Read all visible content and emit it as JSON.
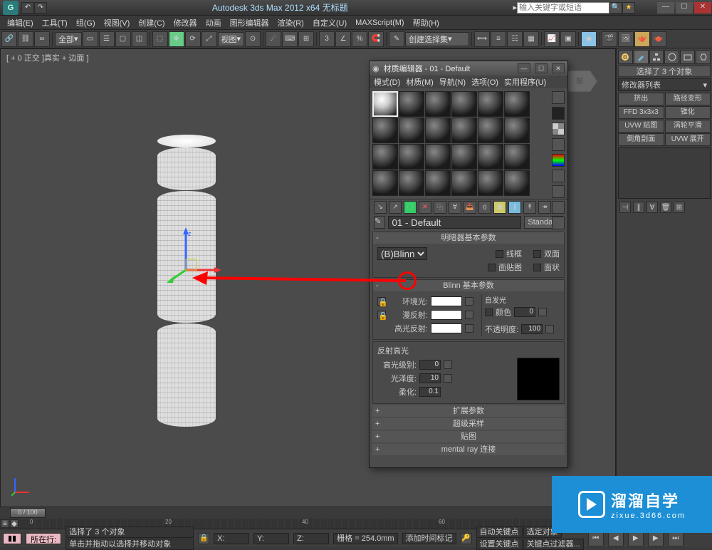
{
  "app": {
    "title": "Autodesk 3ds Max  2012  x64   无标题",
    "search_ph": "输入关键字或短语"
  },
  "menu": [
    "编辑(E)",
    "工具(T)",
    "组(G)",
    "视图(V)",
    "创建(C)",
    "修改器",
    "动画",
    "图形编辑器",
    "渲染(R)",
    "自定义(U)",
    "MAXScript(M)",
    "帮助(H)"
  ],
  "toolbar": {
    "all": "全部",
    "view": "视图",
    "selset": "创建选择集"
  },
  "viewport": {
    "label": "[ + 0 正交 ]真实 + 边面 ]"
  },
  "cmdpanel": {
    "sel": "选择了 3 个对象",
    "modlist": "修改器列表",
    "mods": [
      "挤出",
      "路径变形",
      "FFD 3x3x3",
      "锥化",
      "UVW 贴图",
      "涡轮平滑",
      "倒角剖面",
      "UVW 展开"
    ]
  },
  "mateditor": {
    "title": "材质编辑器 - 01 - Default",
    "menu": [
      "模式(D)",
      "材质(M)",
      "导航(N)",
      "选项(O)",
      "实用程序(U)"
    ],
    "name": "01 - Default",
    "standard": "Standard",
    "rollouts": {
      "shader_hdr": "明暗器基本参数",
      "shader": "(B)Blinn",
      "wire": "线框",
      "twoSided": "双面",
      "faceMap": "面贴图",
      "faceted": "面状",
      "blinn_hdr": "Blinn 基本参数",
      "ambient": "环境光:",
      "diffuse": "漫反射:",
      "specular": "高光反射:",
      "selfillum": "自发光",
      "color": "颜色",
      "opacity": "不透明度:",
      "spec_hdr": "反射高光",
      "spec_level": "高光级别:",
      "gloss": "光泽度:",
      "soften": "柔化:",
      "spec_level_v": "0",
      "gloss_v": "10",
      "soften_v": "0.1",
      "si_v": "0",
      "op_v": "100",
      "ext": "扩展参数",
      "ss": "超级采样",
      "maps": "贴图",
      "mr": "mental ray 连接"
    }
  },
  "status": {
    "sel": "选择了 3 个对象",
    "hint": "单击并拖动以选择并移动对象",
    "addtime": "添加时间标记",
    "x": "X:",
    "y": "Y:",
    "z": "Z:",
    "grid": "栅格 = 254.0mm",
    "autokey": "自动关键点",
    "selkey": "选定对象",
    "setkey": "设置关键点",
    "keyfilter": "关键点过滤器...",
    "location_label": "所在行:",
    "frame": "0 / 100"
  },
  "watermark": {
    "big": "溜溜自学",
    "small": "zixue.3d66.com"
  }
}
